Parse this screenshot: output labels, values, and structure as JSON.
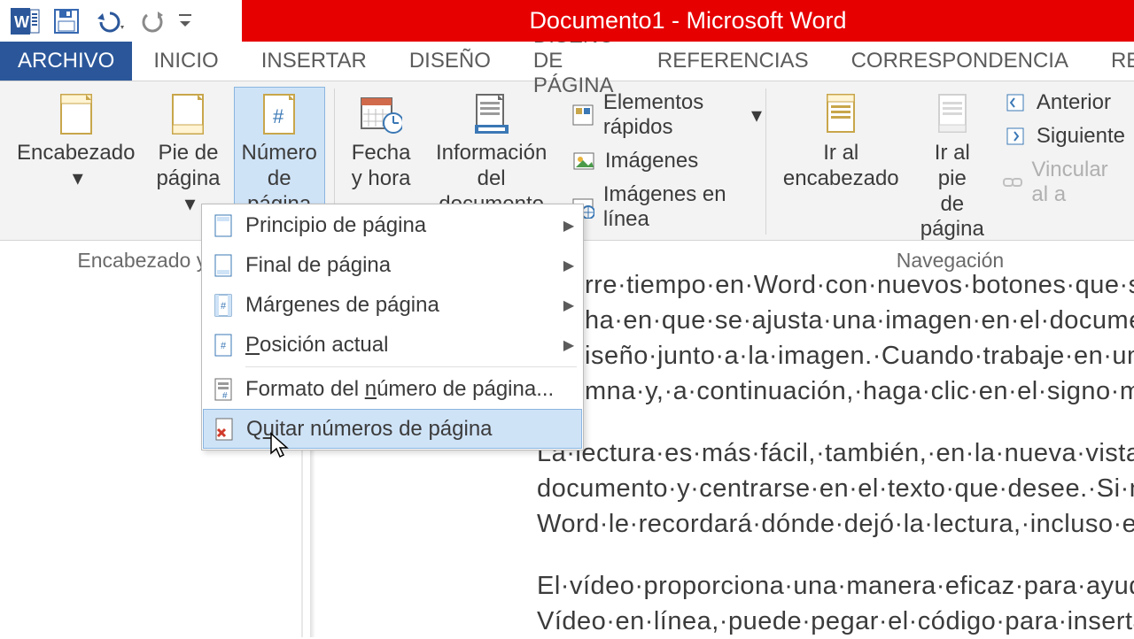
{
  "titlebar": {
    "title": "Documento1 -  Microsoft Word"
  },
  "tabs": {
    "file": "ARCHIVO",
    "items": [
      "INICIO",
      "INSERTAR",
      "DISEÑO",
      "DISEÑO DE PÁGINA",
      "REFERENCIAS",
      "CORRESPONDENCIA",
      "REV"
    ]
  },
  "ribbon": {
    "group_hf_label": "Encabezado y pie d",
    "encabezado": "Encabezado",
    "pie": "Pie de página",
    "numero": "Número de página",
    "fecha": "Fecha y hora",
    "info_doc": "Información del documento",
    "elementos": "Elementos rápidos",
    "imagenes": "Imágenes",
    "imagenes_linea": "Imágenes en línea",
    "ir_enc": "Ir al encabezado",
    "ir_pie": "Ir al pie de página",
    "anterior": "Anterior",
    "siguiente": "Siguiente",
    "vincular": "Vincular al a",
    "nav_label": "Navegación"
  },
  "menu": {
    "top_page": "Principio de página",
    "bottom_page": "Final de página",
    "margins": "Márgenes de página",
    "current_pos": "Posición actual",
    "format": "Formato del número de página...",
    "remove": "Quitar números de página"
  },
  "doc": {
    "p1l1": "rre·tiempo·en·Word·con·nuevos·botones·que·s",
    "p1l2": "ha·en·que·se·ajusta·una·imagen·en·el·documen",
    "p1l3": "iseño·junto·a·la·imagen.·Cuando·trabaje·en·un",
    "p1l4": "mna·y,·a·continuación,·haga·clic·en·el·signo·m",
    "p2l1": "La·lectura·es·más·fácil,·también,·en·la·nueva·vista·d",
    "p2l2": "documento·y·centrarse·en·el·texto·que·desee.·Si·ne",
    "p2l3": "Word·le·recordará·dónde·dejó·la·lectura,·incluso·e",
    "p3l1": "El·vídeo·proporciona·una·manera·eficaz·para·ayud",
    "p3l2": "Vídeo·en·línea,·puede·pegar·el·código·para·inserta"
  }
}
